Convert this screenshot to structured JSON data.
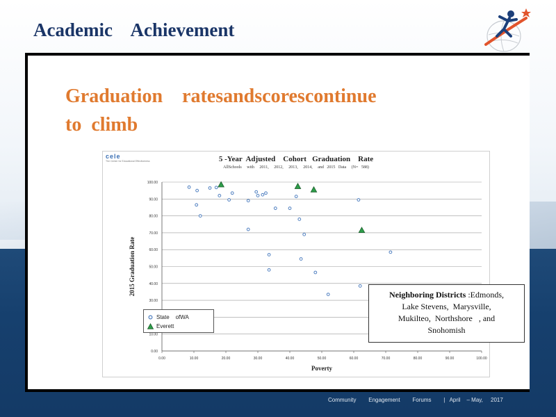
{
  "page": {
    "title": "Academic    Achievement",
    "headline": "Graduation    ratesandscorescontinue\nto  climb",
    "footer": "Community        Engagement        Forums        |   April    – May,     2017"
  },
  "logo": {
    "icon": "running-figure-globe-star-logo",
    "colors": [
      "#1c3f7a",
      "#e2542c",
      "#c8ccd2"
    ]
  },
  "chart_logo": {
    "text": "cele",
    "subtext": "The Center for Educational Effectiveness"
  },
  "note": {
    "bold": "Neighboring    Districts",
    "text": " :Edmonds,\nLake Stevens,  Marysville,\nMukilteo,  Northshore   , and\nSnohomish"
  },
  "chart_data": {
    "type": "scatter",
    "title": "5 -Year  Adjusted    Cohort   Graduation    Rate",
    "subtitle": "AllSchools     with     2011,     2012,     2013,     2014,     and   2015   Data     (N=   588)",
    "xlabel": "Poverty",
    "ylabel": "2015   Graduation     Rate",
    "xlim": [
      0,
      100
    ],
    "ylim": [
      0,
      100
    ],
    "x_ticks": [
      "0.00",
      "10.00",
      "20.00",
      "30.00",
      "40.00",
      "50.00",
      "60.00",
      "70.00",
      "80.00",
      "90.00",
      "100.00"
    ],
    "y_ticks": [
      "0.00",
      "10.00",
      "20.00",
      "30.00",
      "40.00",
      "50.00",
      "60.00",
      "70.00",
      "80.00",
      "90.00",
      "100.00"
    ],
    "grid": true,
    "legend_position": "bottom-left",
    "series": [
      {
        "name": "State    ofWA",
        "marker": "circle",
        "color": "#4f7fc0",
        "points": [
          [
            8.5,
            97
          ],
          [
            11,
            95
          ],
          [
            15,
            96.5
          ],
          [
            17,
            96.8
          ],
          [
            18,
            92
          ],
          [
            10.8,
            86.5
          ],
          [
            12,
            80
          ],
          [
            21,
            89.5
          ],
          [
            22,
            93.5
          ],
          [
            27,
            89
          ],
          [
            29.5,
            94.2
          ],
          [
            30,
            92
          ],
          [
            31.5,
            92.5
          ],
          [
            32.5,
            93.5
          ],
          [
            35.5,
            84.5
          ],
          [
            27,
            72
          ],
          [
            40,
            84.5
          ],
          [
            42,
            91.5
          ],
          [
            43,
            78
          ],
          [
            44.5,
            69
          ],
          [
            33.5,
            57
          ],
          [
            33.5,
            48
          ],
          [
            43.5,
            54.5
          ],
          [
            48,
            46.5
          ],
          [
            52,
            33.5
          ],
          [
            61.5,
            89.5
          ],
          [
            62,
            38.5
          ],
          [
            71.5,
            58.5
          ]
        ]
      },
      {
        "name": "Everett",
        "marker": "triangle",
        "color": "#1f7d3a",
        "points": [
          [
            18.5,
            98.5
          ],
          [
            42.5,
            97.5
          ],
          [
            47.5,
            95.5
          ],
          [
            62.5,
            71.5
          ]
        ]
      }
    ]
  }
}
